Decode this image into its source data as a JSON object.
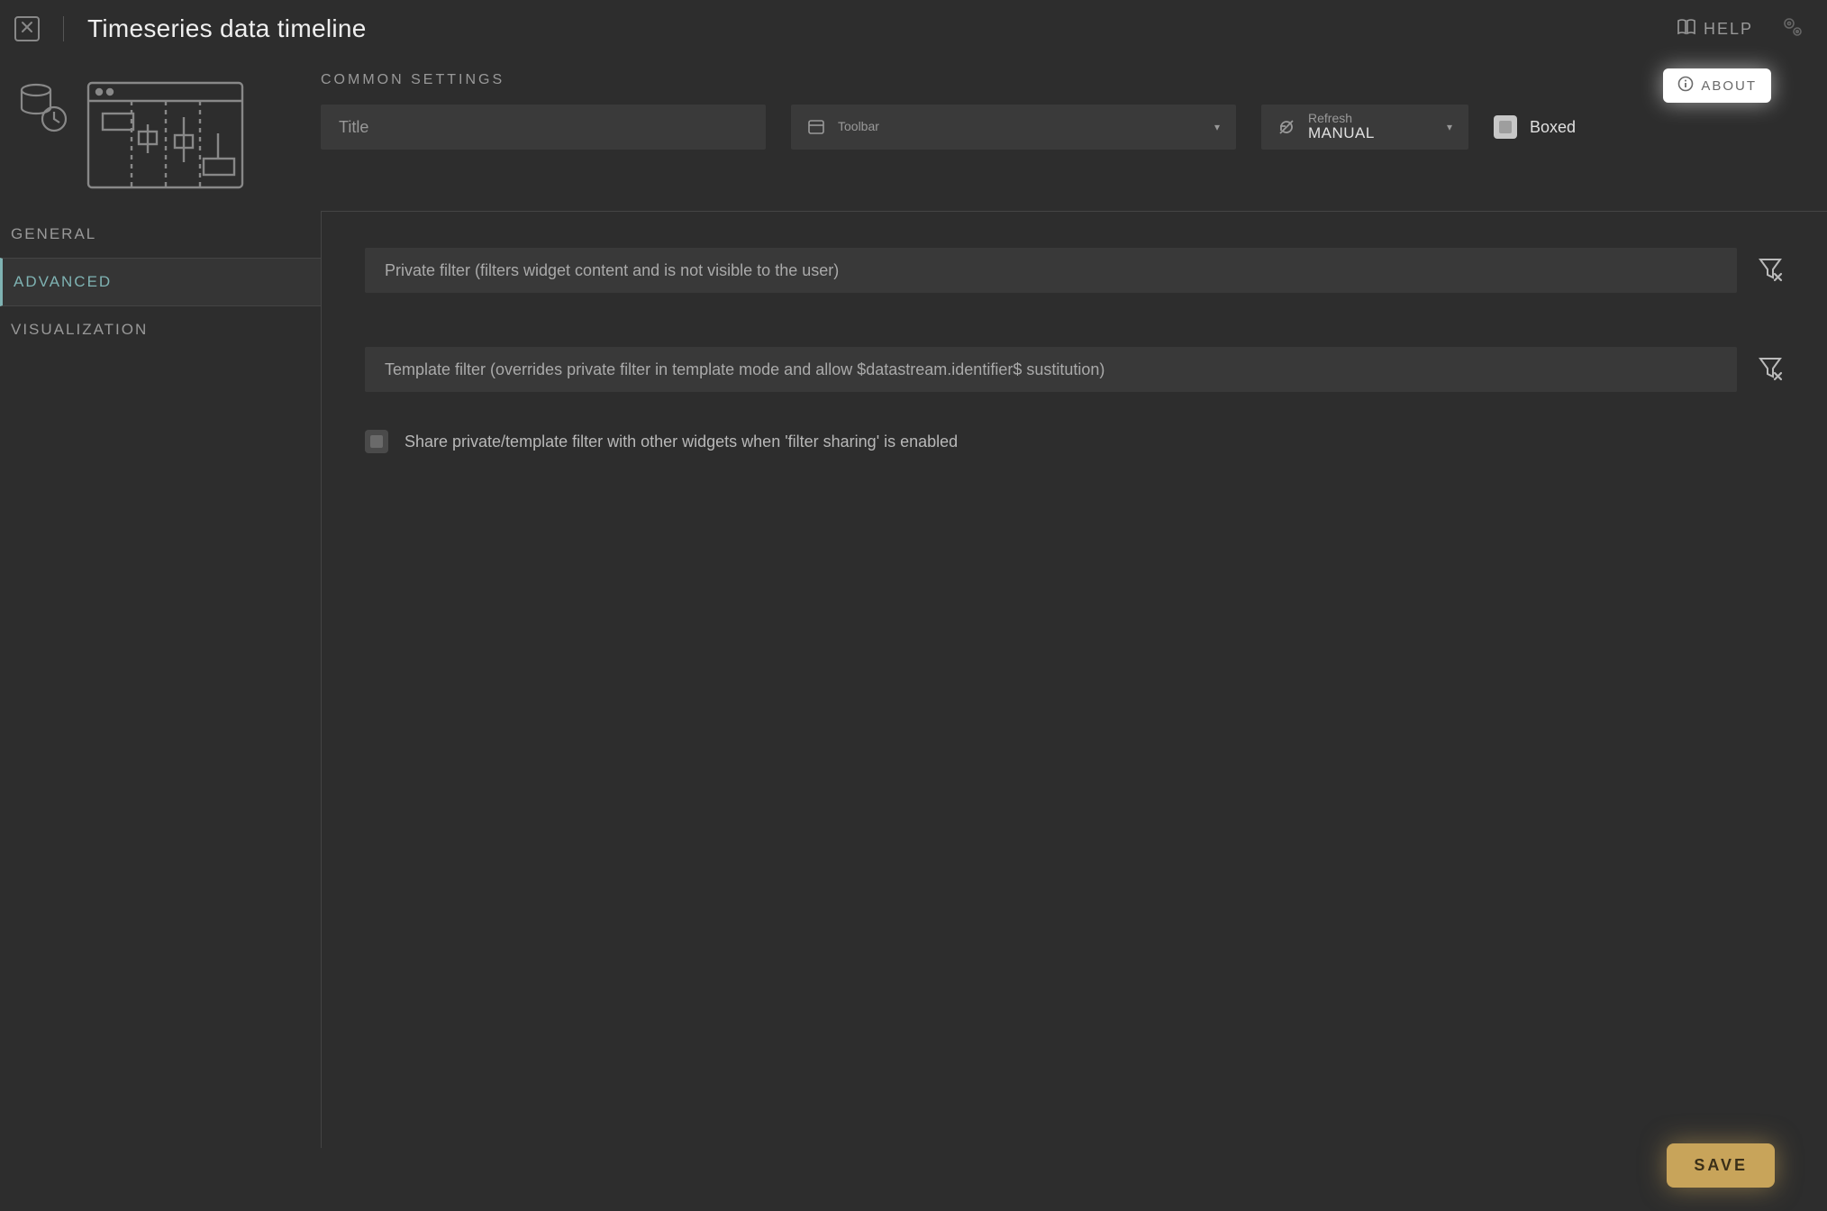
{
  "header": {
    "title": "Timeseries data timeline",
    "help_label": "HELP"
  },
  "about_button": "ABOUT",
  "common": {
    "heading": "COMMON SETTINGS",
    "title_placeholder": "Title",
    "title_value": "",
    "toolbar_label": "Toolbar",
    "toolbar_value": "",
    "refresh_label": "Refresh",
    "refresh_value": "MANUAL",
    "boxed_label": "Boxed",
    "boxed_checked": false
  },
  "tabs": [
    {
      "label": "GENERAL",
      "active": false
    },
    {
      "label": "ADVANCED",
      "active": true
    },
    {
      "label": "VISUALIZATION",
      "active": false
    }
  ],
  "advanced": {
    "private_filter_placeholder": "Private filter (filters widget content and is not visible to the user)",
    "private_filter_value": "",
    "template_filter_placeholder": "Template filter (overrides private filter in template mode and allow $datastream.identifier$ sustitution)",
    "template_filter_value": "",
    "share_label": "Share private/template filter with other widgets when 'filter sharing' is enabled",
    "share_checked": false
  },
  "footer": {
    "save_label": "SAVE"
  }
}
